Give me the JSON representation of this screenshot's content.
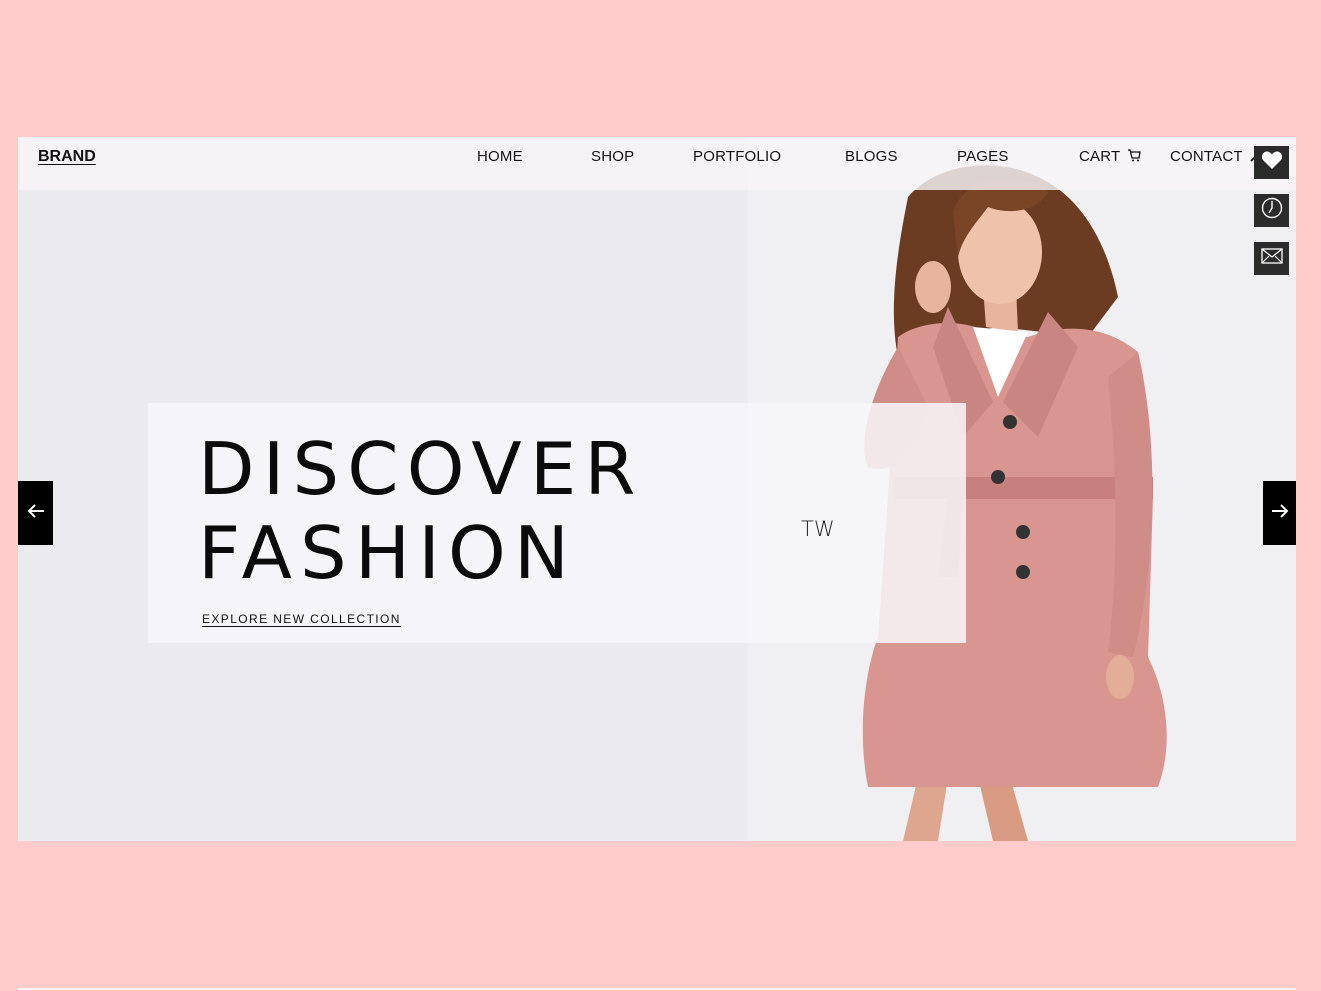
{
  "header": {
    "brand": "BRAND",
    "nav": [
      "HOME",
      "SHOP",
      "PORTFOLIO",
      "BLOGS",
      "PAGES",
      "CART",
      "CONTACT"
    ]
  },
  "hero": {
    "title_line1": "DISCOVER",
    "title_line2": "FASHION",
    "cta": "EXPLORE NEW COLLECTION",
    "watermark": "TW"
  },
  "side_actions": [
    "heart-icon",
    "clock-icon",
    "mail-icon"
  ],
  "colors": {
    "page_bg": "#ffcccb",
    "hero_bg": "#ebeaee",
    "coat": "#d9958f",
    "button_dark": "#2b2b2b"
  }
}
